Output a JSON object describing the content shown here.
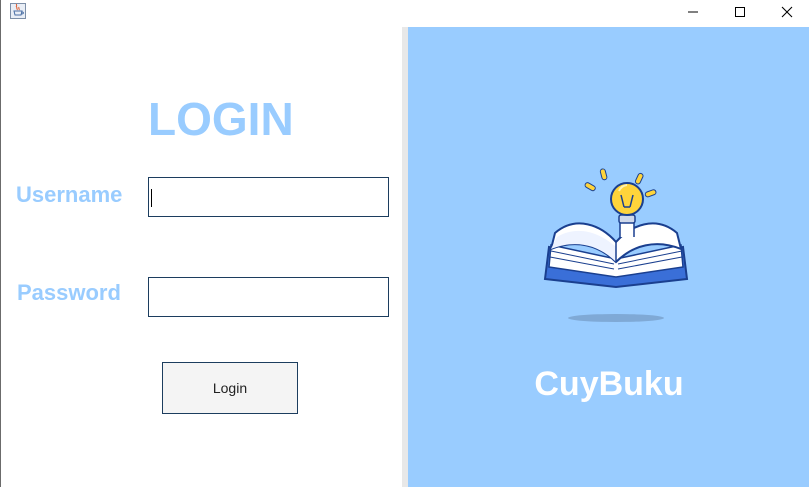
{
  "window": {
    "app_icon": "java-app-icon",
    "controls": [
      "minimize-icon",
      "maximize-icon",
      "close-icon"
    ]
  },
  "login_form": {
    "title": "LOGIN",
    "username_label": "Username",
    "username_value": "",
    "password_label": "Password",
    "password_value": "",
    "login_button_label": "Login"
  },
  "brand": {
    "illustration": "open-book-lightbulb-illustration",
    "name": "CuyBuku"
  },
  "colors": {
    "accent": "#99ccff",
    "field_border": "#1c3d5e",
    "brand_text": "#ffffff"
  }
}
